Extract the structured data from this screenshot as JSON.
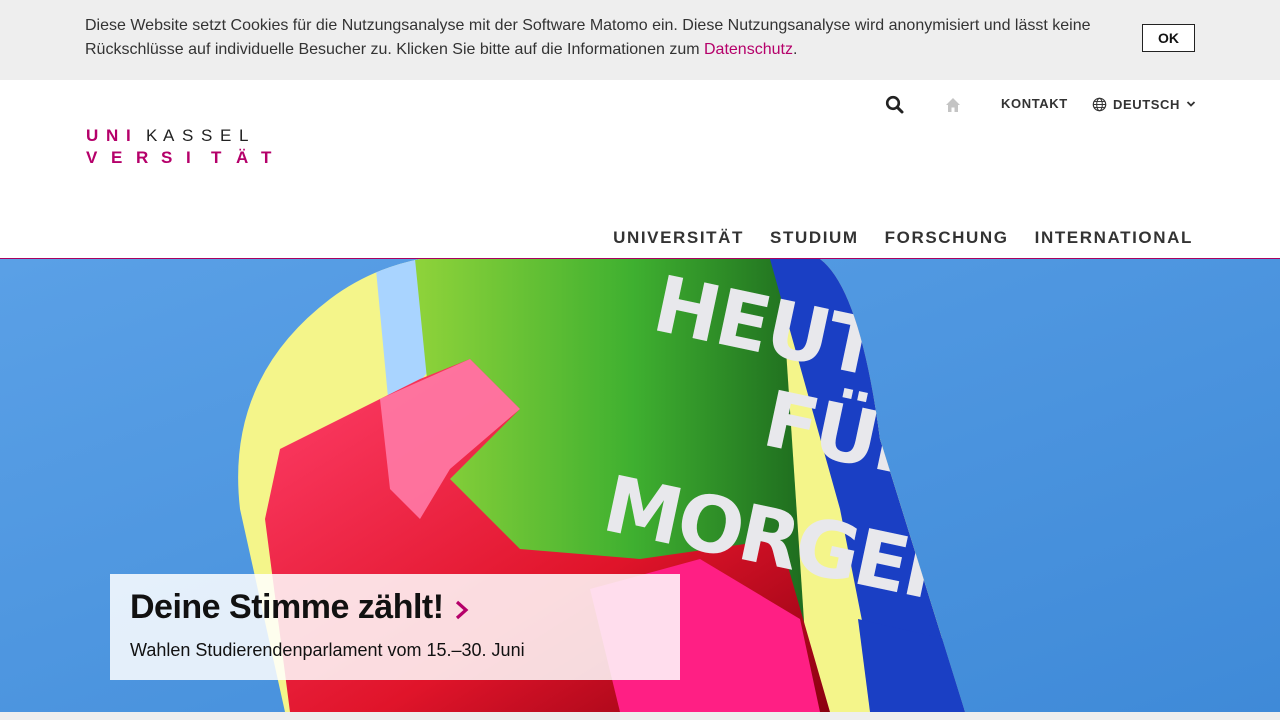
{
  "cookie_banner": {
    "text_before_link": "Diese Website setzt Cookies für die Nutzungsanalyse mit der Software Matomo ein. Diese Nutzungsanalyse wird anonymisiert und lässt keine Rückschlüsse auf individuelle Besucher zu. Klicken Sie bitte auf die Informationen zum ",
    "link_label": "Datenschutz",
    "text_after_link": ".",
    "ok_label": "OK"
  },
  "logo": {
    "row1_magenta": [
      "U",
      "N",
      "I"
    ],
    "row1_black": [
      "K",
      "A",
      "S",
      "S",
      "E",
      "L"
    ],
    "row2_magenta": [
      "V",
      "E",
      "R",
      "S",
      "I",
      "T",
      "Ä",
      "T"
    ]
  },
  "utility_nav": {
    "search_icon": "search-icon",
    "home_icon": "home-icon",
    "contact_label": "KONTAKT",
    "language_icon": "globe-icon",
    "language_label": "DEUTSCH",
    "language_chevron": "chevron-down-icon"
  },
  "main_nav": {
    "items": [
      "UNIVERSITÄT",
      "STUDIUM",
      "FORSCHUNG",
      "INTERNATIONAL"
    ]
  },
  "hero": {
    "image_lettering": [
      "HEUTE",
      "FÜR",
      "MORGEN"
    ],
    "teaser_title": "Deine Stimme zählt!",
    "teaser_arrow_icon": "chevron-right-icon",
    "teaser_subtitle": "Wahlen Studierendenparlament vom 15.–30. Juni"
  },
  "colors": {
    "brand_magenta": "#b5006a",
    "banner_bg": "#eeeeee",
    "sky": "#4f97e0"
  }
}
